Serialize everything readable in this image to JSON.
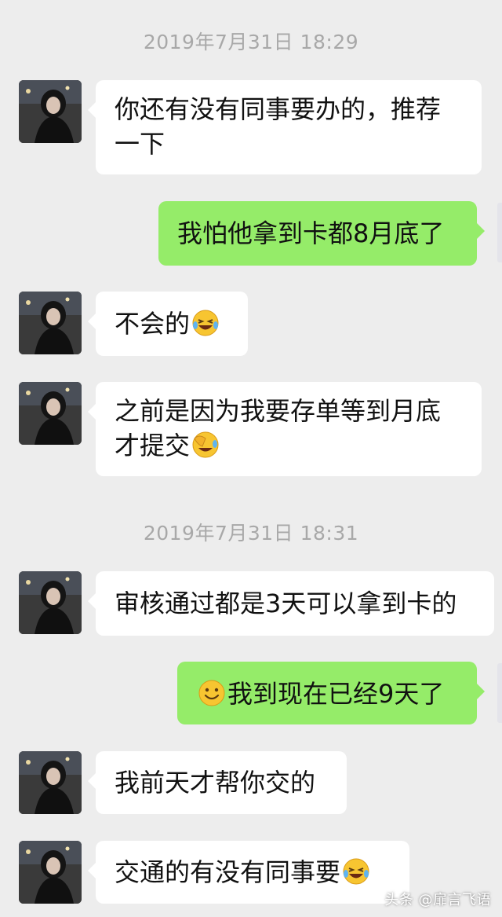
{
  "timestamps": [
    "2019年7月31日 18:29",
    "2019年7月31日 18:31"
  ],
  "messages": [
    {
      "side": "in",
      "lines": [
        "你还有没有同事要办的，推荐",
        "一下"
      ]
    },
    {
      "side": "out",
      "text": "我怕他拿到卡都8月底了"
    },
    {
      "side": "in",
      "text": "不会的",
      "emoji_after": "laughing-tears-emoji"
    },
    {
      "side": "in",
      "lines": [
        "之前是因为我要存单等到月底",
        "才提交"
      ],
      "emoji_after": "facepalm-laughing-emoji"
    },
    {
      "side": "in",
      "text": "审核通过都是3天可以拿到卡的"
    },
    {
      "side": "out",
      "text": "我到现在已经9天了",
      "emoji_before": "smile-emoji"
    },
    {
      "side": "in",
      "text": "我前天才帮你交的"
    },
    {
      "side": "in",
      "text": "交通的有没有同事要",
      "emoji_after": "laughing-tears-emoji"
    }
  ],
  "watermark": "头条 @扉言飞语",
  "colors": {
    "background": "#ededed",
    "incoming_bubble": "#ffffff",
    "outgoing_bubble": "#95ec69",
    "timestamp": "#a8a8a8"
  }
}
